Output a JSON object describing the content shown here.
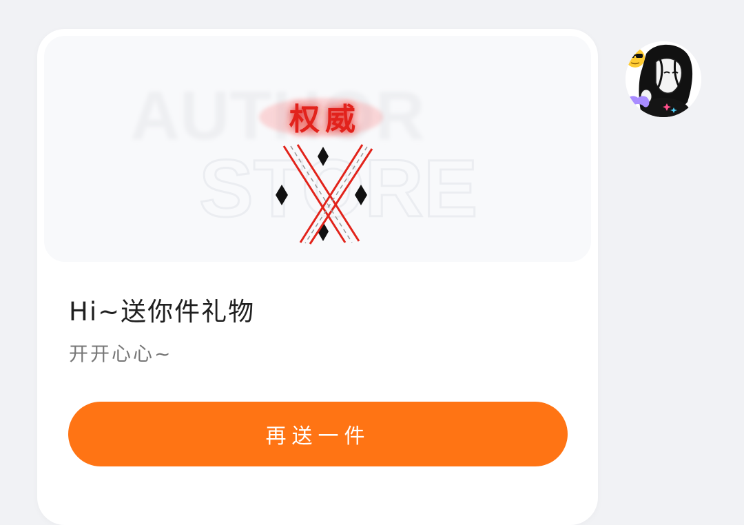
{
  "gift_card": {
    "image": {
      "watermark_line1": "AUTHOR",
      "watermark_line2": "STORE",
      "badge_text": "权威"
    },
    "title": "Hi~送你件礼物",
    "subtitle": "开开心心~",
    "send_again_button": "再送一件"
  },
  "colors": {
    "accent": "#ff7414",
    "background": "#f1f2f5",
    "card": "#ffffff",
    "badge_red": "#e2231a"
  },
  "icons": {
    "avatar": "user-avatar-anime-girl",
    "gift": "playing-card-diamonds-crossed"
  }
}
